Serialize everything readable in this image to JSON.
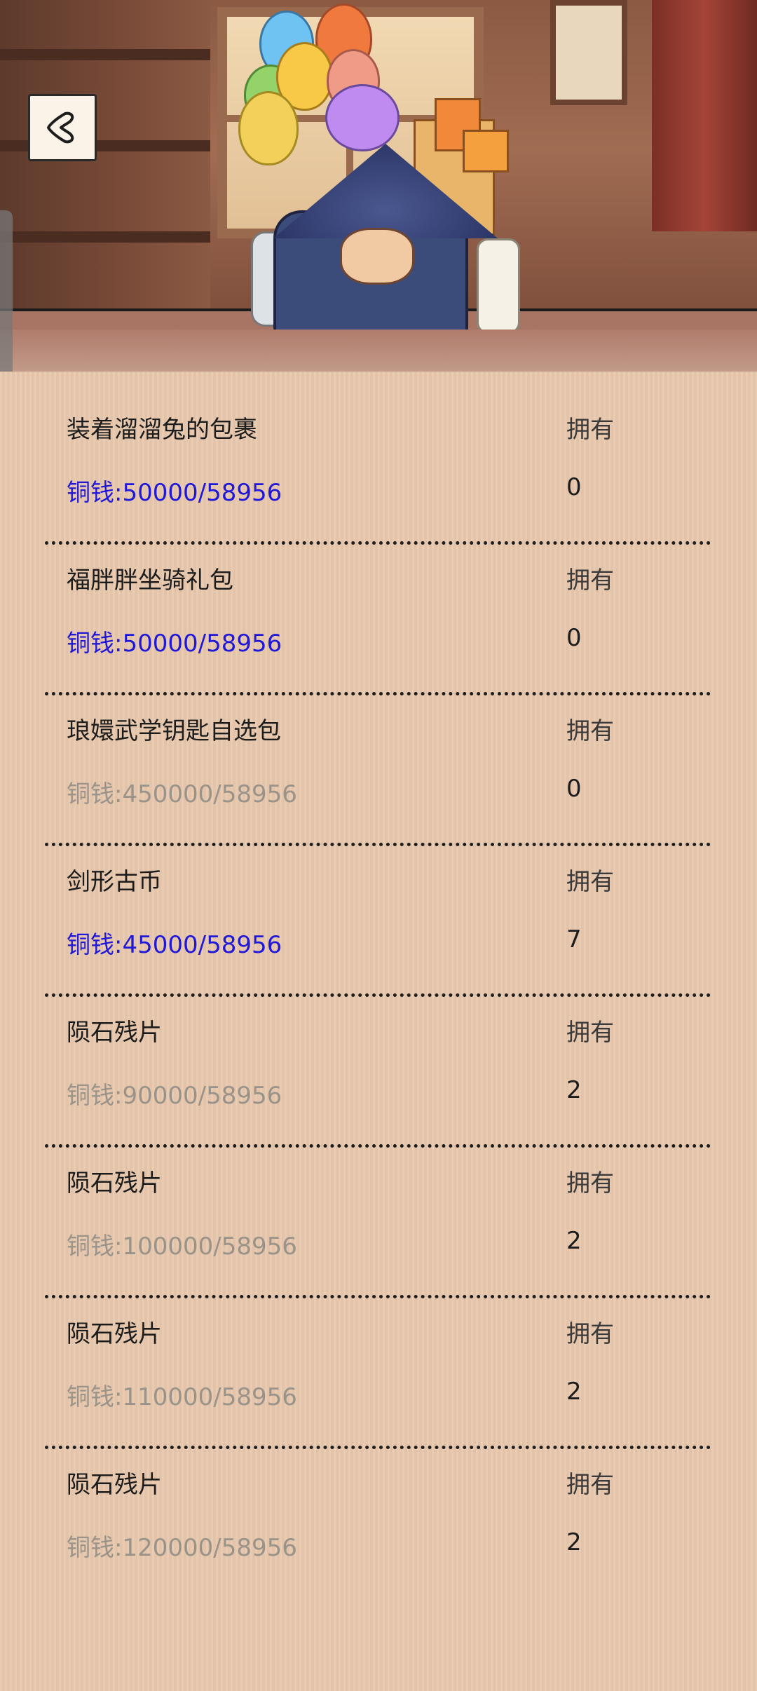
{
  "header": {
    "back_icon": "back-arrow-icon",
    "illustration": "merchant-with-balloons-and-gifts"
  },
  "colors": {
    "affordable_price": "#2018d8",
    "unaffordable_price": "#9a938a",
    "background": "#e8c8ad"
  },
  "items": [
    {
      "name": "装着溜溜兔的包裹",
      "own_label": "拥有",
      "price": "铜钱:50000/58956",
      "owned": "0",
      "affordable": true
    },
    {
      "name": "福胖胖坐骑礼包",
      "own_label": "拥有",
      "price": "铜钱:50000/58956",
      "owned": "0",
      "affordable": true
    },
    {
      "name": "琅嬛武学钥匙自选包",
      "own_label": "拥有",
      "price": "铜钱:450000/58956",
      "owned": "0",
      "affordable": false
    },
    {
      "name": "剑形古币",
      "own_label": "拥有",
      "price": "铜钱:45000/58956",
      "owned": "7",
      "affordable": true
    },
    {
      "name": "陨石残片",
      "own_label": "拥有",
      "price": "铜钱:90000/58956",
      "owned": "2",
      "affordable": false
    },
    {
      "name": "陨石残片",
      "own_label": "拥有",
      "price": "铜钱:100000/58956",
      "owned": "2",
      "affordable": false
    },
    {
      "name": "陨石残片",
      "own_label": "拥有",
      "price": "铜钱:110000/58956",
      "owned": "2",
      "affordable": false
    },
    {
      "name": "陨石残片",
      "own_label": "拥有",
      "price": "铜钱:120000/58956",
      "owned": "2",
      "affordable": false
    }
  ]
}
